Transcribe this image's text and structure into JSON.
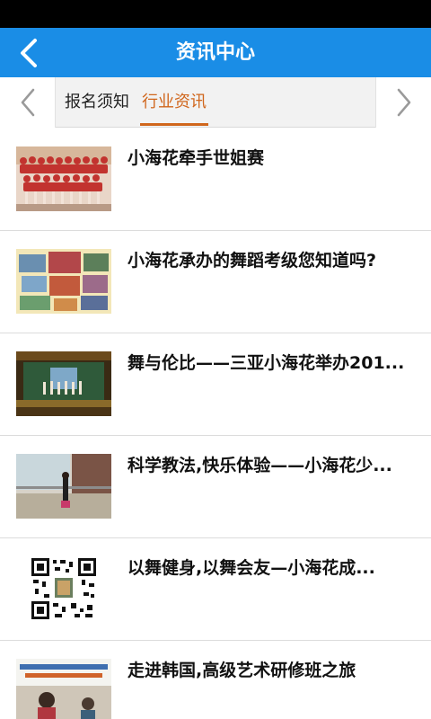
{
  "header": {
    "title": "资讯中心",
    "bar_color": "#1a8de6",
    "back_icon": "chevron-left-icon"
  },
  "tabs": {
    "items": [
      {
        "label": "报名须知",
        "active": false
      },
      {
        "label": "行业资讯",
        "active": true
      }
    ],
    "active_color": "#d0661c",
    "prev_icon": "chevron-left-icon",
    "next_icon": "chevron-right-icon"
  },
  "news": {
    "items": [
      {
        "title": "小海花牵手世姐赛",
        "thumb": "group-photo"
      },
      {
        "title": "小海花承办的舞蹈考级您知道吗?",
        "thumb": "collage-photo"
      },
      {
        "title": "舞与伦比——三亚小海花举办201...",
        "thumb": "stage-photo"
      },
      {
        "title": "科学教法,快乐体验——小海花少...",
        "thumb": "studio-photo"
      },
      {
        "title": "以舞健身,以舞会友—小海花成...",
        "thumb": "qr-code"
      },
      {
        "title": "走进韩国,高级艺术研修班之旅",
        "thumb": "banner-photo"
      }
    ]
  }
}
